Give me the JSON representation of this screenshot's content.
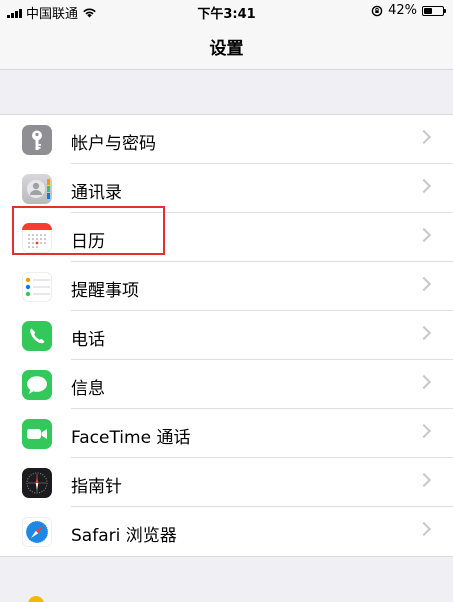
{
  "status_bar": {
    "carrier": "中国联通",
    "time": "下午3:41",
    "battery_percent": "42%",
    "battery_level": 0.42
  },
  "nav": {
    "title": "设置"
  },
  "settings": {
    "items": [
      {
        "label": "帐户与密码",
        "icon": "key-icon",
        "color": "#8e8e93"
      },
      {
        "label": "通讯录",
        "icon": "contacts-icon",
        "color": "#c9c9ce"
      },
      {
        "label": "日历",
        "icon": "calendar-icon",
        "color": "#ffffff"
      },
      {
        "label": "提醒事项",
        "icon": "reminders-icon",
        "color": "#ffffff"
      },
      {
        "label": "电话",
        "icon": "phone-icon",
        "color": "#34c759"
      },
      {
        "label": "信息",
        "icon": "messages-icon",
        "color": "#34c759"
      },
      {
        "label": "FaceTime 通话",
        "icon": "facetime-icon",
        "color": "#34c759"
      },
      {
        "label": "指南针",
        "icon": "compass-icon",
        "color": "#1c1c1e"
      },
      {
        "label": "Safari 浏览器",
        "icon": "safari-icon",
        "color": "#ffffff"
      }
    ]
  },
  "annotation": {
    "highlight_color": "#e03030"
  }
}
